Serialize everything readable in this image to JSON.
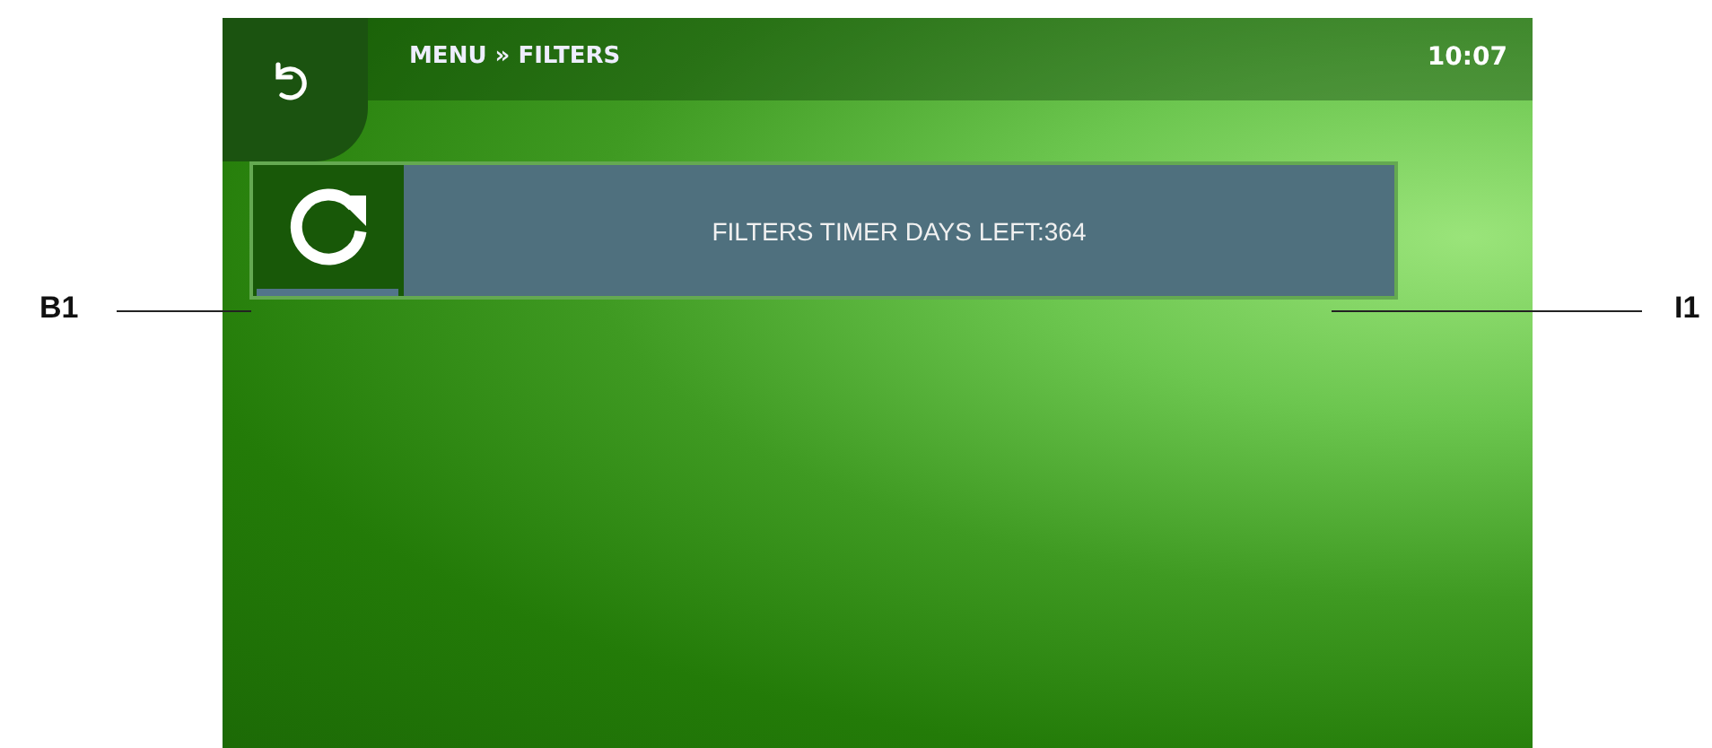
{
  "callouts": [
    {
      "label": "B1"
    },
    {
      "label": "I1"
    }
  ],
  "header": {
    "breadcrumb": "MENU » FILTERS",
    "time": "10:07"
  },
  "filter_timer": {
    "text": "FILTERS TIMER DAYS LEFT:364"
  }
}
